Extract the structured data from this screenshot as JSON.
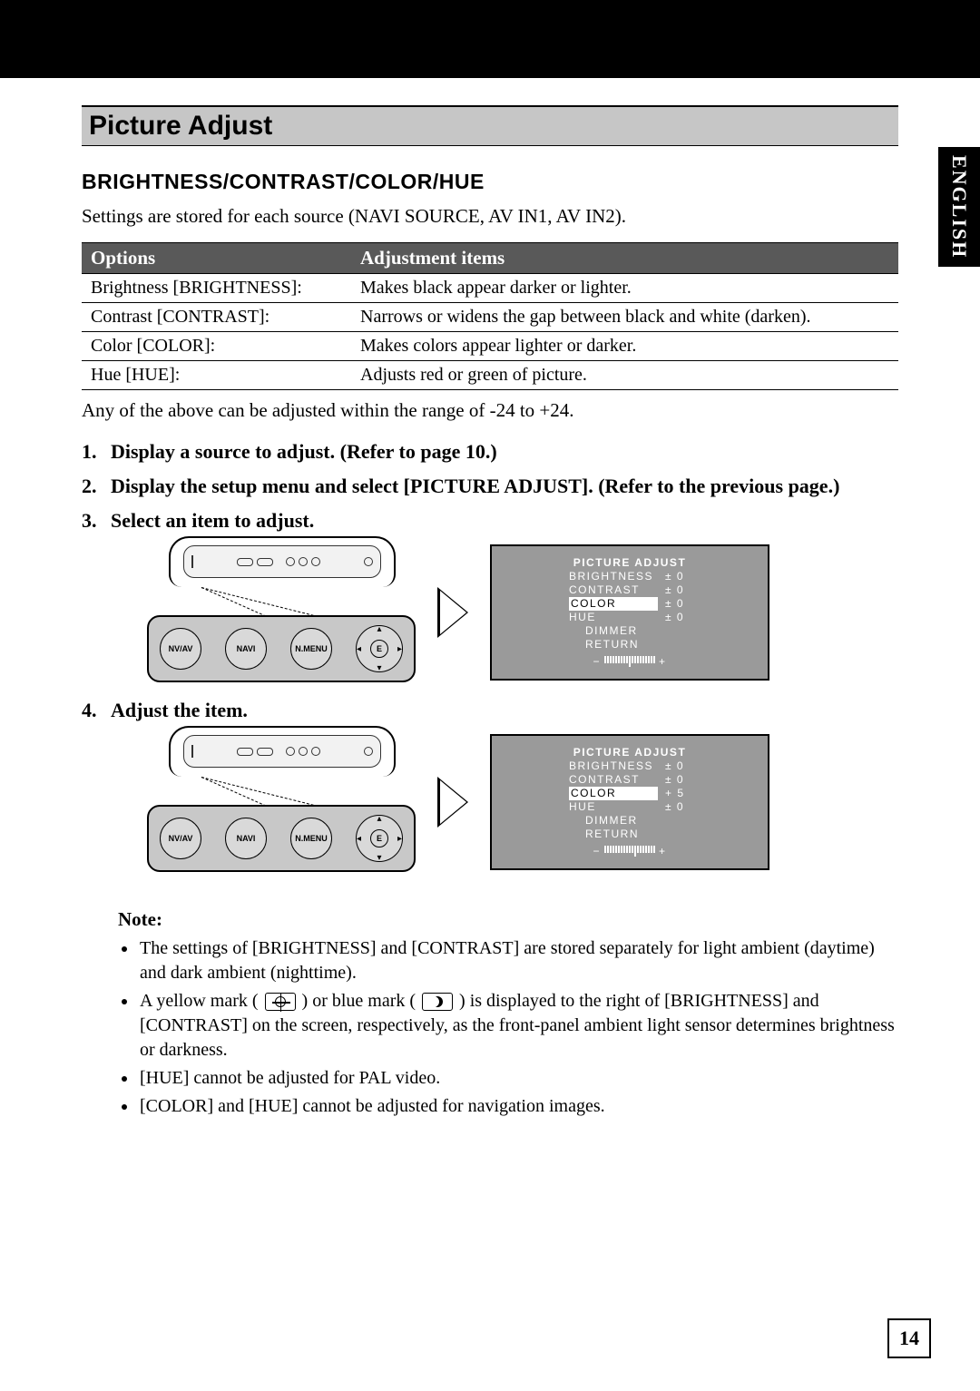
{
  "sideTab": "ENGLISH",
  "pageNumber": "14",
  "sectionTitle": "Picture Adjust",
  "subheading": "BRIGHTNESS/CONTRAST/COLOR/HUE",
  "intro": "Settings are stored for each source (NAVI SOURCE, AV IN1, AV IN2).",
  "table": {
    "head": {
      "options": "Options",
      "adj": "Adjustment items"
    },
    "rows": [
      {
        "option": "Brightness [BRIGHTNESS]:",
        "desc": "Makes black appear darker or lighter."
      },
      {
        "option": "Contrast [CONTRAST]:",
        "desc": "Narrows or widens the gap between black and white (darken)."
      },
      {
        "option": "Color [COLOR]:",
        "desc": "Makes colors appear lighter or darker."
      },
      {
        "option": "Hue [HUE]:",
        "desc": "Adjusts red or green of picture."
      }
    ]
  },
  "rangeNote": "Any of the above can be adjusted within the range of -24 to +24.",
  "steps": [
    "Display a source to adjust. (Refer to page 10.)",
    "Display the setup menu and select [PICTURE ADJUST]. (Refer to the previous page.)",
    "Select an item to adjust.",
    "Adjust the item."
  ],
  "device": {
    "btn1": "NV/AV",
    "btn2": "NAVI",
    "btn3": "N.MENU",
    "center": "E"
  },
  "osd1": {
    "title": "PICTURE  ADJUST",
    "rows": [
      {
        "label": "BRIGHTNESS",
        "val": "± 0"
      },
      {
        "label": "CONTRAST",
        "val": "± 0"
      },
      {
        "label": "COLOR",
        "val": "± 0",
        "selected": true
      },
      {
        "label": "HUE",
        "val": "± 0"
      },
      {
        "label": "DIMMER",
        "val": ""
      },
      {
        "label": "RETURN",
        "val": ""
      }
    ],
    "minus": "−",
    "plus": "+"
  },
  "osd2": {
    "title": "PICTURE  ADJUST",
    "rows": [
      {
        "label": "BRIGHTNESS",
        "val": "± 0"
      },
      {
        "label": "CONTRAST",
        "val": "± 0"
      },
      {
        "label": "COLOR",
        "val": "+ 5",
        "selected": true
      },
      {
        "label": "HUE",
        "val": "± 0"
      },
      {
        "label": "DIMMER",
        "val": ""
      },
      {
        "label": "RETURN",
        "val": ""
      }
    ],
    "minus": "−",
    "plus": "+"
  },
  "noteHeading": "Note:",
  "notes": {
    "n1": "The settings of [BRIGHTNESS] and [CONTRAST] are stored separately for light ambient (daytime) and dark ambient (nighttime).",
    "n2a": "A yellow mark (",
    "n2b": ") or blue mark (",
    "n2c": ") is displayed to the right of [BRIGHTNESS] and [CONTRAST] on the screen, respectively, as the front-panel ambient light sensor determines brightness or darkness.",
    "n3": "[HUE] cannot be adjusted for PAL video.",
    "n4": "[COLOR] and [HUE] cannot be adjusted for navigation images."
  }
}
